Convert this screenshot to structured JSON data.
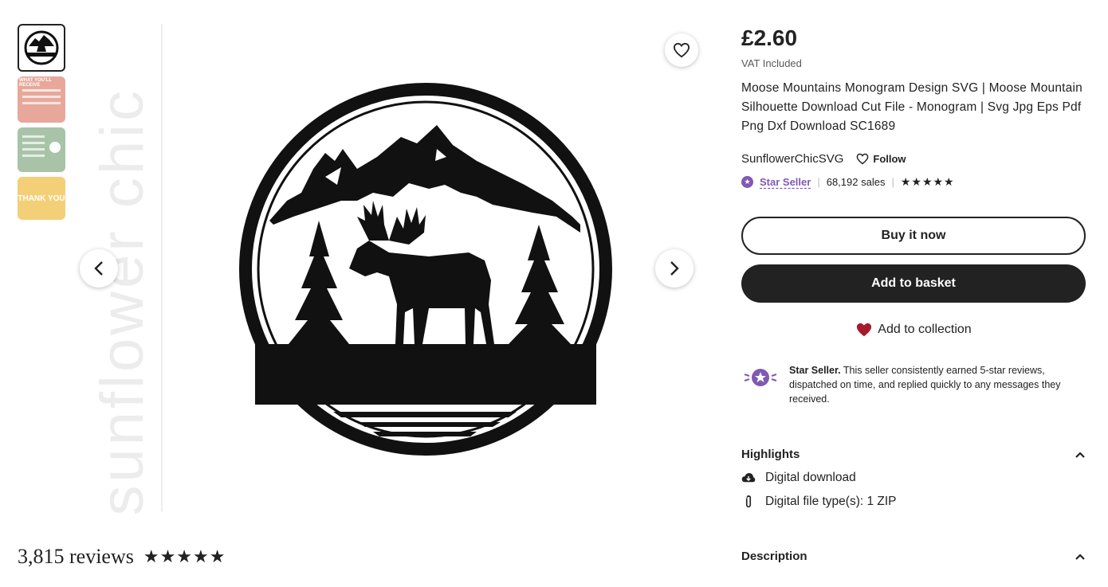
{
  "listing": {
    "price": "£2.60",
    "vat_note": "VAT Included",
    "title": "Moose Mountains Monogram Design SVG | Moose Mountain Silhouette Download Cut File - Monogram | Svg Jpg Eps Pdf Png Dxf Download SC1689"
  },
  "shop": {
    "name": "SunflowerChicSVG",
    "follow_label": "Follow",
    "star_seller_label": "Star Seller",
    "sales": "68,192 sales",
    "rating_stars": "★★★★★"
  },
  "actions": {
    "buy_now": "Buy it now",
    "add_to_basket": "Add to basket",
    "add_to_collection": "Add to collection"
  },
  "star_seller_info": {
    "heading": "Star Seller.",
    "text": " This seller consistently earned 5-star reviews, dispatched on time, and replied quickly to any messages they received."
  },
  "highlights": {
    "heading": "Highlights",
    "items": [
      {
        "icon": "cloud-download-icon",
        "label": "Digital download"
      },
      {
        "icon": "paperclip-icon",
        "label": "Digital file type(s): 1 ZIP"
      }
    ]
  },
  "description": {
    "heading": "Description"
  },
  "reviews": {
    "count": "3,815 reviews",
    "stars": "★★★★★"
  },
  "thumbnails": [
    {
      "label": "",
      "active": true
    },
    {
      "label": "WHAT YOU'LL RECEIVE",
      "active": false
    },
    {
      "label": "",
      "active": false
    },
    {
      "label": "THANK YOU",
      "active": false
    }
  ],
  "watermark": "sunflower chic",
  "colors": {
    "primary_text": "#222222",
    "star_seller_purple": "#7f59b4",
    "heart_red": "#a61a2e",
    "thumb_pink": "#e7a89b",
    "thumb_green": "#a9c3a9",
    "thumb_yellow": "#f3d077"
  }
}
